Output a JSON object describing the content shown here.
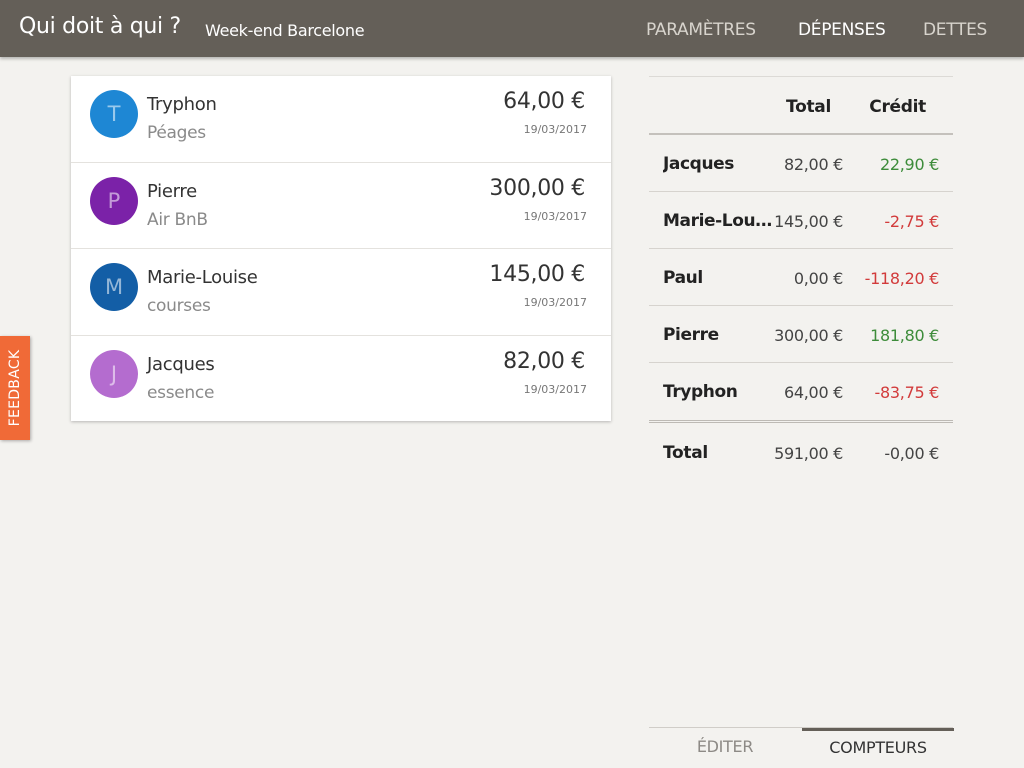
{
  "header": {
    "app_title": "Qui doit à qui ?",
    "project_name": "Week-end Barcelone",
    "nav": [
      {
        "label": "Paramètres",
        "active": false
      },
      {
        "label": "Dépenses",
        "active": true
      },
      {
        "label": "Dettes",
        "active": false
      }
    ]
  },
  "expenses": [
    {
      "initial": "T",
      "avatar_color": "#1e87d4",
      "payer": "Tryphon",
      "description": "Péages",
      "amount": "64,00 €",
      "date": "19/03/2017"
    },
    {
      "initial": "P",
      "avatar_color": "#7b22a8",
      "payer": "Pierre",
      "description": "Air BnB",
      "amount": "300,00 €",
      "date": "19/03/2017"
    },
    {
      "initial": "M",
      "avatar_color": "#135ea6",
      "payer": "Marie-Louise",
      "description": "courses",
      "amount": "145,00 €",
      "date": "19/03/2017"
    },
    {
      "initial": "J",
      "avatar_color": "#b46ccf",
      "payer": "Jacques",
      "description": "essence",
      "amount": "82,00 €",
      "date": "19/03/2017"
    }
  ],
  "balance": {
    "header_total": "Total",
    "header_credit": "Crédit",
    "rows": [
      {
        "name": "Jacques",
        "total": "82,00 €",
        "credit": "22,90 €",
        "sign": "pos"
      },
      {
        "name": "Marie-Louise",
        "total": "145,00 €",
        "credit": "-2,75 €",
        "sign": "neg"
      },
      {
        "name": "Paul",
        "total": "0,00 €",
        "credit": "-118,20 €",
        "sign": "neg"
      },
      {
        "name": "Pierre",
        "total": "300,00 €",
        "credit": "181,80 €",
        "sign": "pos"
      },
      {
        "name": "Tryphon",
        "total": "64,00 €",
        "credit": "-83,75 €",
        "sign": "neg"
      }
    ],
    "footer": {
      "label": "Total",
      "total": "591,00 €",
      "credit": "-0,00 €"
    }
  },
  "bottom_tabs": [
    {
      "label": "Éditer",
      "active": false
    },
    {
      "label": "Compteurs",
      "active": true
    }
  ],
  "feedback_label": "FEEDBACK",
  "colors": {
    "header_bg": "#645f58",
    "positive": "#3d8c3a",
    "negative": "#d23b3b",
    "feedback": "#f06a37"
  }
}
